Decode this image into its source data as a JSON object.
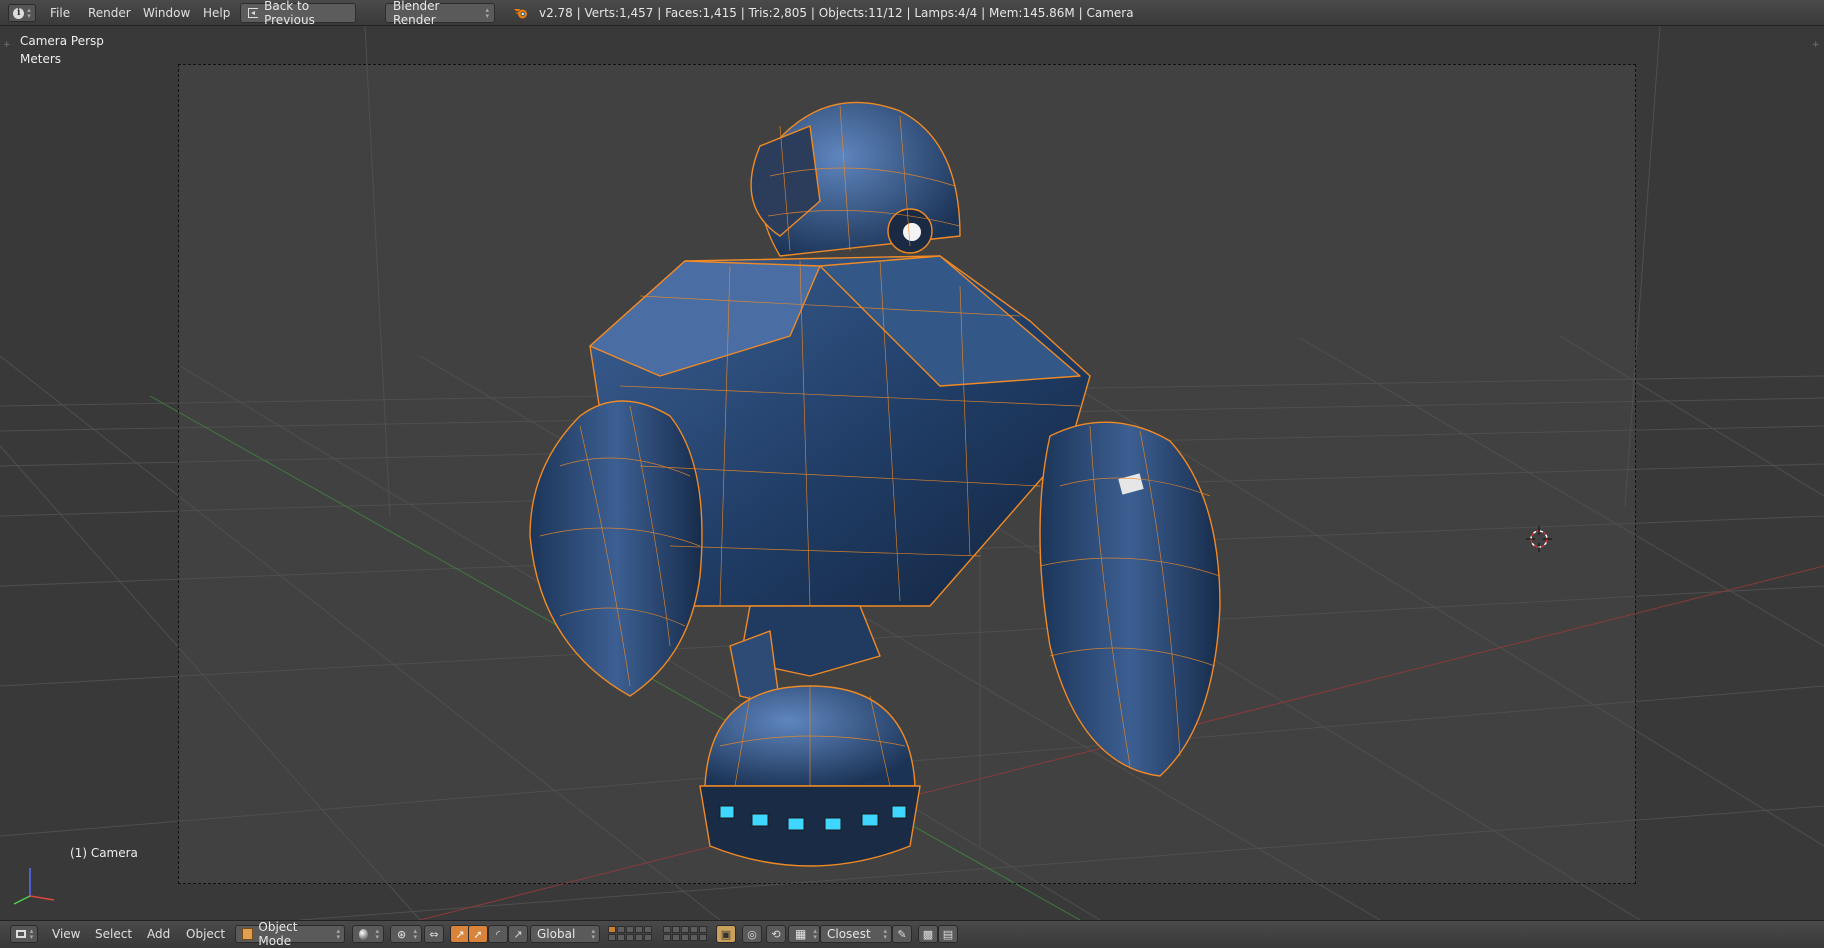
{
  "top_header": {
    "menu": [
      "File",
      "Render",
      "Window",
      "Help"
    ],
    "back_button": "Back to Previous",
    "render_engine": "Blender Render",
    "stats": "v2.78 | Verts:1,457 | Faces:1,415 | Tris:2,805 | Objects:11/12 | Lamps:4/4 | Mem:145.86M | Camera"
  },
  "viewport": {
    "view_name": "Camera Persp",
    "units": "Meters",
    "active_object": "(1) Camera"
  },
  "bottom_header": {
    "menu": [
      "View",
      "Select",
      "Add",
      "Object"
    ],
    "mode": "Object Mode",
    "orientation": "Global",
    "snap_target": "Closest"
  },
  "colors": {
    "header_bg": "#404040",
    "viewport_bg": "#393939",
    "selection_outline": "#f08a24",
    "model_blue": "#2a4a78",
    "accent_orange": "#d9843a"
  }
}
